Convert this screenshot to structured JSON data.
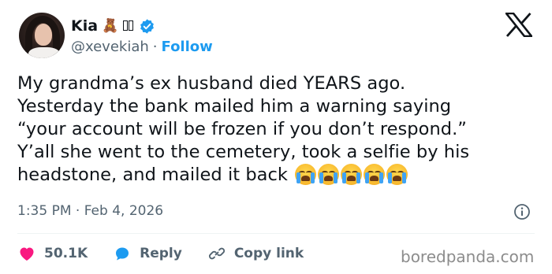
{
  "author": {
    "name": "Kia",
    "handle": "@xevekiah",
    "name_emoji": "🧸",
    "separator": "·",
    "follow_label": "Follow"
  },
  "tweet": {
    "lines": [
      "My grandma’s ex husband died YEARS ago.",
      "Yesterday the bank mailed him a warning saying",
      "“your account will be frozen if you don’t respond.”",
      "Y’all she went to the cemetery, took a selfie by his",
      "headstone, and mailed it back"
    ],
    "emojis": [
      "loudly-crying-face",
      "loudly-crying-face",
      "loudly-crying-face",
      "loudly-crying-face",
      "loudly-crying-face"
    ],
    "timestamp": "1:35 PM · Feb 4, 2026"
  },
  "actions": {
    "likes_count": "50.1K",
    "reply_label": "Reply",
    "copy_link_label": "Copy link"
  },
  "watermark": "boredpanda.com",
  "colors": {
    "accent": "#1d9bf0",
    "like": "#f91880",
    "text": "#0f1419",
    "muted": "#536471"
  }
}
